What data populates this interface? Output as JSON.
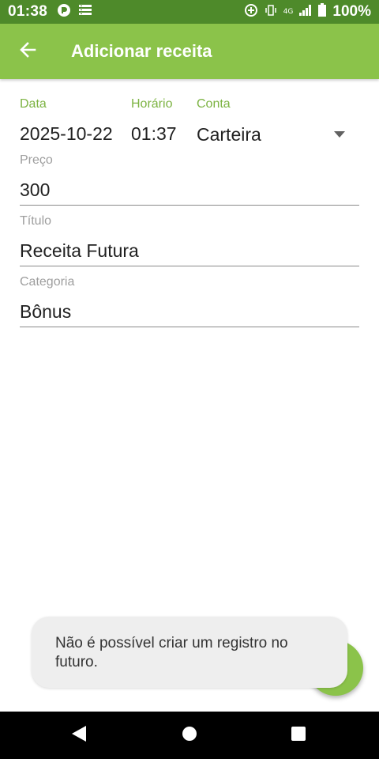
{
  "status_bar": {
    "time": "01:38",
    "battery_percent": "100%",
    "network_label": "4G",
    "icons": [
      "vpn-key-icon",
      "storage-icon",
      "data-saver-icon",
      "vibrate-icon",
      "signal-icon",
      "battery-icon"
    ]
  },
  "app_bar": {
    "title": "Adicionar receita",
    "back_icon": "arrow-back-icon",
    "color": "#8bc34a"
  },
  "form": {
    "date": {
      "label": "Data",
      "value": "2025-10-22"
    },
    "time": {
      "label": "Horário",
      "value": "01:37"
    },
    "account": {
      "label": "Conta",
      "value": "Carteira"
    },
    "price": {
      "label": "Preço",
      "value": "300"
    },
    "title": {
      "label": "Título",
      "value": "Receita Futura"
    },
    "category": {
      "label": "Categoria",
      "value": "Bônus"
    }
  },
  "snackbar": {
    "message": "Não é possível criar um registro no futuro."
  },
  "fab": {
    "icon": "check-icon"
  },
  "nav_bar": {
    "icons": [
      "back-triangle-icon",
      "home-circle-icon",
      "recents-square-icon"
    ]
  },
  "colors": {
    "accent": "#8bc34a",
    "status_bar": "#4e8a2a",
    "label_accent": "#7cb342"
  }
}
